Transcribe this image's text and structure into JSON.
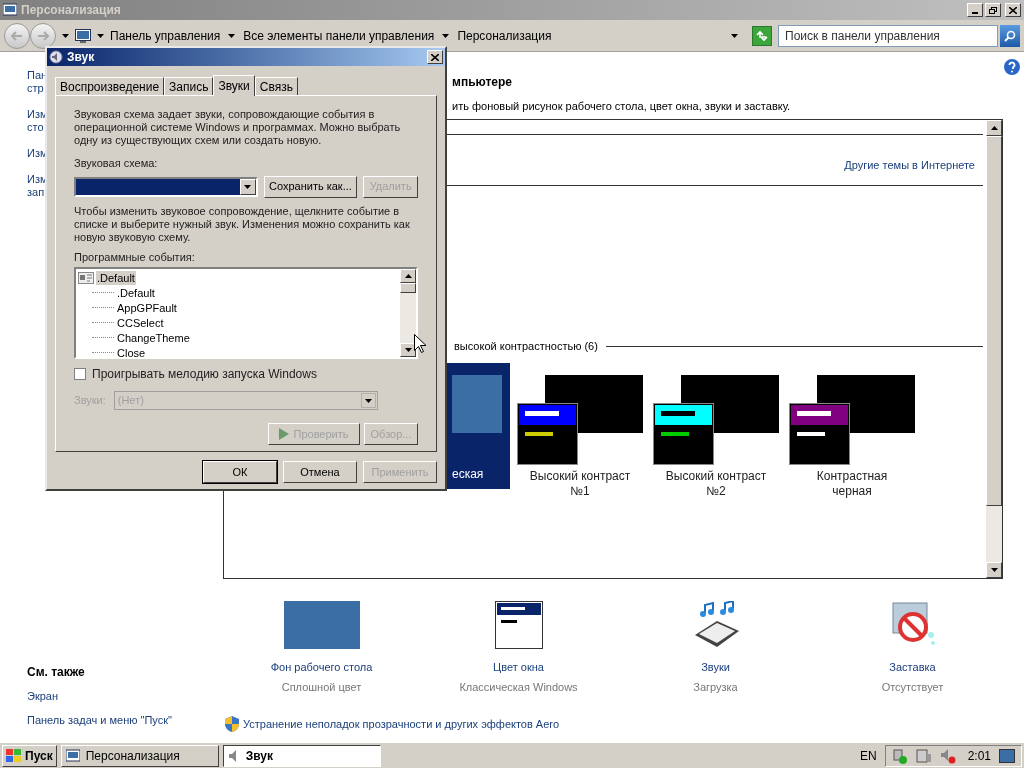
{
  "window": {
    "title": "Персонализация"
  },
  "address_bar": {
    "breadcrumbs": [
      "Панель управления",
      "Все элементы панели управления",
      "Персонализация"
    ],
    "search": {
      "placeholder": "Поиск в панели управления"
    }
  },
  "sidebar": {
    "links": [
      {
        "lines": [
          "Пан",
          "стр"
        ]
      },
      {
        "lines": [
          "Изм",
          "сто"
        ]
      },
      {
        "lines": [
          "Изм"
        ]
      },
      {
        "lines": [
          "Изм",
          "зап"
        ]
      }
    ],
    "see_also": {
      "title": "См. также",
      "links": [
        "Экран",
        "Панель задач и меню \"Пуск\""
      ]
    }
  },
  "content": {
    "heading": "мпьютере",
    "description": "ить фоновый рисунок рабочего стола, цвет окна, звуки и заставку.",
    "online_link": "Другие темы в Интернете",
    "section_title": "высокой контрастностью (6)",
    "themes": [
      {
        "name": "еская",
        "selected": true,
        "kind": "classic"
      },
      {
        "name": "Высокий контраст №1",
        "selected": false,
        "kind": "contrast",
        "bars": [
          {
            "color": "#0000ff"
          },
          {
            "color": "#cccc00"
          }
        ]
      },
      {
        "name": "Высокий контраст №2",
        "selected": false,
        "kind": "contrast",
        "bars": [
          {
            "color": "#00ffff"
          },
          {
            "color": "#00cc00"
          }
        ]
      },
      {
        "name": "Контрастная черная",
        "selected": false,
        "kind": "contrast",
        "bars": [
          {
            "color": "#800080"
          },
          {
            "color": "#ffffff"
          }
        ]
      }
    ],
    "settings": [
      {
        "kind": "background",
        "label": "Фон рабочего стола",
        "value": "Сплошной цвет"
      },
      {
        "kind": "color",
        "label": "Цвет окна",
        "value": "Классическая Windows"
      },
      {
        "kind": "sounds",
        "label": "Звуки",
        "value": "Загрузка"
      },
      {
        "kind": "screensaver",
        "label": "Заставка",
        "value": "Отсутствует"
      }
    ],
    "aero_link": "Устранение неполадок прозрачности и других эффектов Aero"
  },
  "dialog": {
    "title": "Звук",
    "tabs": [
      {
        "label": "Воспроизведение",
        "selected": false
      },
      {
        "label": "Запись",
        "selected": false
      },
      {
        "label": "Звуки",
        "selected": true
      },
      {
        "label": "Связь",
        "selected": false
      }
    ],
    "intro": "Звуковая схема задает звуки, сопровождающие события в операционной системе Windows и программах. Можно выбрать одну из существующих схем или создать новую.",
    "scheme_label": "Звуковая схема:",
    "scheme_buttons": [
      {
        "label": "Сохранить как...",
        "disabled": false
      },
      {
        "label": "Удалить",
        "disabled": true
      }
    ],
    "hint": "Чтобы изменить звуковое сопровождение, щелкните событие в списке и выберите нужный звук. Изменения можно сохранить как новую звуковую схему.",
    "events_label": "Программные события:",
    "events": [
      {
        "label": ".Default",
        "selected": true,
        "children": [
          {
            "label": ".Default",
            "selected": false
          },
          {
            "label": "AppGPFault",
            "selected": false
          },
          {
            "label": "CCSelect",
            "selected": false
          },
          {
            "label": "ChangeTheme",
            "selected": false
          },
          {
            "label": "Close",
            "selected": false
          }
        ]
      }
    ],
    "startup_sound": {
      "label": "Проигрывать мелодию запуска Windows",
      "checked": false
    },
    "sounds_label": "Звуки:",
    "sounds_value": "(Нет)",
    "sounds_disabled": true,
    "test_buttons": [
      {
        "label": "Проверить",
        "disabled": true,
        "kind": "play"
      },
      {
        "label": "Обзор...",
        "disabled": true,
        "kind": "plain"
      }
    ],
    "buttons": [
      {
        "label": "ОК",
        "disabled": false
      },
      {
        "label": "Отмена",
        "disabled": false
      },
      {
        "label": "Применить",
        "disabled": true
      }
    ]
  },
  "taskbar": {
    "start": "Пуск",
    "tasks": [
      {
        "label": "Персонализация",
        "selected": false
      },
      {
        "label": "Звук",
        "selected": true
      }
    ],
    "language": "EN",
    "clock": "2:01"
  }
}
